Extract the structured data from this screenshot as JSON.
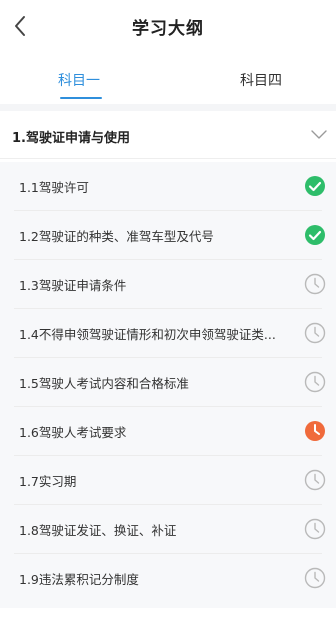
{
  "header": {
    "title": "学习大纲",
    "back_icon": "chevron-left-icon"
  },
  "tabs": [
    {
      "label": "科目一",
      "active": true
    },
    {
      "label": "科目四",
      "active": false
    }
  ],
  "section": {
    "title": "1.驾驶证申请与使用",
    "toggle_icon": "chevron-down-icon"
  },
  "colors": {
    "accent": "#2f8fdc",
    "done": "#2ebd6a",
    "in_progress": "#f06a3b",
    "pending": "#b9b9b9"
  },
  "items": [
    {
      "label": "1.1驾驶许可",
      "status": "done",
      "icon": "check-circle-icon"
    },
    {
      "label": "1.2驾驶证的种类、准驾车型及代号",
      "status": "done",
      "icon": "check-circle-icon"
    },
    {
      "label": "1.3驾驶证申请条件",
      "status": "pending",
      "icon": "clock-icon"
    },
    {
      "label": "1.4不得申领驾驶证情形和初次申领驾驶证类...",
      "status": "pending",
      "icon": "clock-icon"
    },
    {
      "label": "1.5驾驶人考试内容和合格标准",
      "status": "pending",
      "icon": "clock-icon"
    },
    {
      "label": "1.6驾驶人考试要求",
      "status": "in_progress",
      "icon": "clock-icon"
    },
    {
      "label": "1.7实习期",
      "status": "pending",
      "icon": "clock-icon"
    },
    {
      "label": "1.8驾驶证发证、换证、补证",
      "status": "pending",
      "icon": "clock-icon"
    },
    {
      "label": "1.9违法累积记分制度",
      "status": "pending",
      "icon": "clock-icon"
    }
  ]
}
